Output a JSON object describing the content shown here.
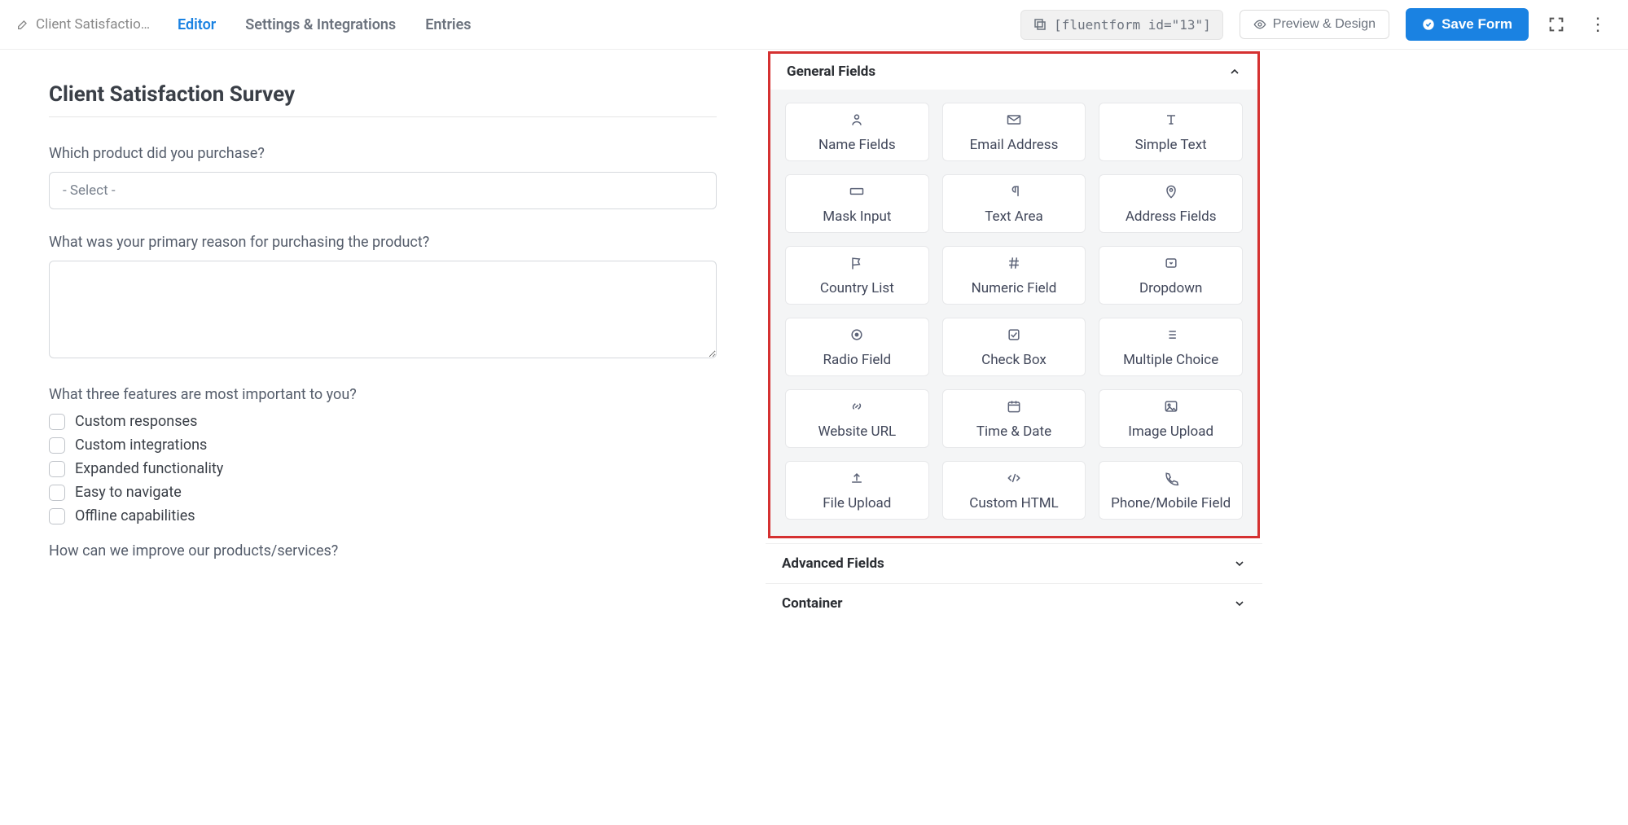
{
  "header": {
    "form_name": "Client Satisfactio…",
    "tabs": [
      "Editor",
      "Settings & Integrations",
      "Entries"
    ],
    "active_tab_index": 0,
    "shortcode": "[fluentform id=\"13\"]",
    "preview_label": "Preview & Design",
    "save_label": "Save Form"
  },
  "form": {
    "title": "Client Satisfaction Survey",
    "q1_label": "Which product did you purchase?",
    "q1_select_placeholder": "- Select -",
    "q2_label": "What was your primary reason for purchasing the product?",
    "q3_label": "What three features are most important to you?",
    "q3_options": [
      "Custom responses",
      "Custom integrations",
      "Expanded functionality",
      "Easy to navigate",
      "Offline capabilities"
    ],
    "q4_label": "How can we improve our products/services?"
  },
  "sidebar": {
    "general_title": "General Fields",
    "fields": [
      {
        "label": "Name Fields",
        "icon": "user"
      },
      {
        "label": "Email Address",
        "icon": "mail"
      },
      {
        "label": "Simple Text",
        "icon": "text"
      },
      {
        "label": "Mask Input",
        "icon": "keyboard"
      },
      {
        "label": "Text Area",
        "icon": "para"
      },
      {
        "label": "Address Fields",
        "icon": "pin"
      },
      {
        "label": "Country List",
        "icon": "flag"
      },
      {
        "label": "Numeric Field",
        "icon": "hash"
      },
      {
        "label": "Dropdown",
        "icon": "dropdown"
      },
      {
        "label": "Radio Field",
        "icon": "radio"
      },
      {
        "label": "Check Box",
        "icon": "check"
      },
      {
        "label": "Multiple Choice",
        "icon": "list"
      },
      {
        "label": "Website URL",
        "icon": "link"
      },
      {
        "label": "Time & Date",
        "icon": "calendar"
      },
      {
        "label": "Image Upload",
        "icon": "image"
      },
      {
        "label": "File Upload",
        "icon": "upload"
      },
      {
        "label": "Custom HTML",
        "icon": "code"
      },
      {
        "label": "Phone/Mobile Field",
        "icon": "phone"
      }
    ],
    "advanced_title": "Advanced Fields",
    "container_title": "Container"
  }
}
